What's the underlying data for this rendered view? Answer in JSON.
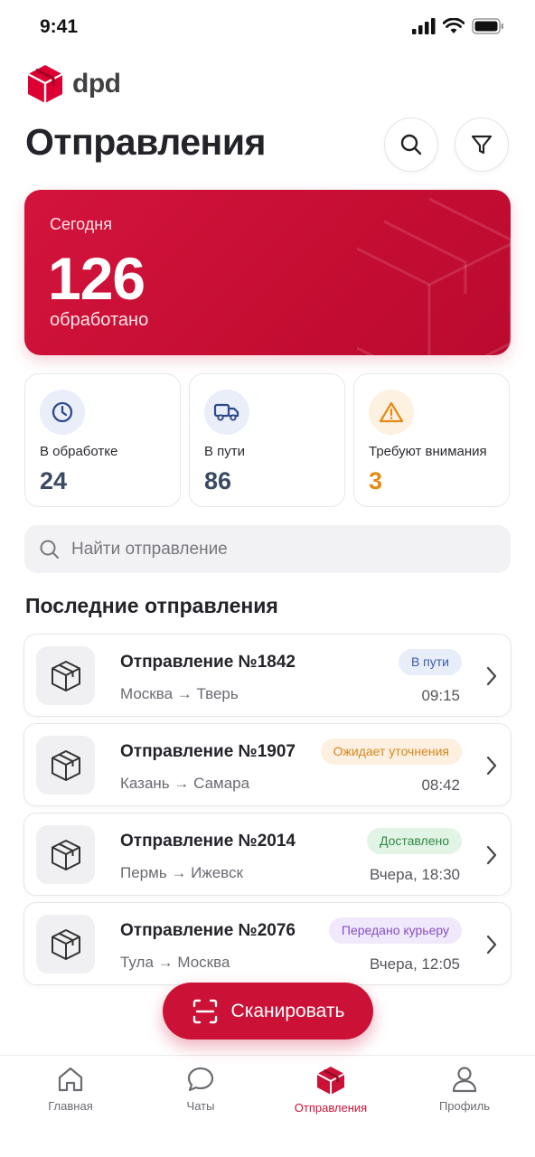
{
  "status_bar": {
    "time": "9:41"
  },
  "brand": {
    "name": "dpd",
    "color": "#dc0032"
  },
  "header": {
    "title": "Отправления"
  },
  "icons": {
    "search": "search-icon",
    "filter": "filter-icon"
  },
  "today": {
    "label": "Сегодня",
    "value": "126",
    "sublabel": "обработано"
  },
  "stats": [
    {
      "label": "В обработке",
      "value": "24",
      "icon": "clock-icon",
      "icon_bg": "#e9eef9",
      "icon_color": "#2f4a8a"
    },
    {
      "label": "В пути",
      "value": "86",
      "icon": "truck-icon",
      "icon_bg": "#e9eef9",
      "icon_color": "#2f4a8a"
    },
    {
      "label": "Требуют внимания",
      "value": "3",
      "icon": "warning-icon",
      "icon_bg": "#fdf1e2",
      "icon_color": "#e58a12"
    }
  ],
  "search": {
    "placeholder": "Найти отправление"
  },
  "recent": {
    "title": "Последние отправления",
    "items": [
      {
        "title": "Отправление №1842",
        "route": "Москва → Тверь",
        "status": "В пути",
        "time": "09:15",
        "badge_color": "blue"
      },
      {
        "title": "Отправление №1907",
        "route": "Казань → Самара",
        "status": "Ожидает уточнения",
        "time": "08:42",
        "badge_color": "orange"
      },
      {
        "title": "Отправление №2014",
        "route": "Пермь → Ижевск",
        "status": "Доставлено",
        "time": "Вчера, 18:30",
        "badge_color": "green"
      },
      {
        "title": "Отправление №2076",
        "route": "Тула → Москва",
        "status": "Передано курьеру",
        "time": "Вчера, 12:05",
        "badge_color": "purple"
      }
    ]
  },
  "scan_button": {
    "label": "Сканировать"
  },
  "tabs": [
    {
      "label": "Главная",
      "icon": "home-icon",
      "active": false
    },
    {
      "label": "Чаты",
      "icon": "chat-icon",
      "active": false
    },
    {
      "label": "Отправления",
      "icon": "package-icon",
      "active": true
    },
    {
      "label": "Профиль",
      "icon": "profile-icon",
      "active": false
    }
  ],
  "colors": {
    "accent": "#cc1136",
    "stat_value": "#3b4a63",
    "warning": "#e58a12"
  }
}
